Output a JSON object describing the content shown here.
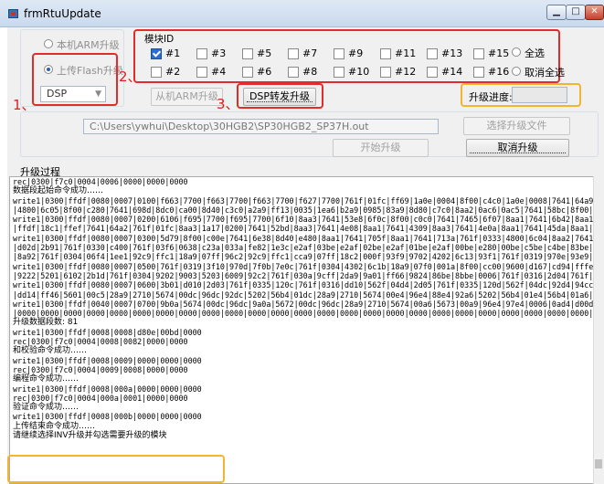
{
  "window": {
    "title": "frmRtuUpdate"
  },
  "mode": {
    "local_arm_label": "本机ARM升级",
    "upload_flash_label": "上传Flash升级",
    "selected": "upload_flash"
  },
  "device_select": {
    "value": "DSP"
  },
  "module": {
    "title": "模块ID",
    "ids": [
      {
        "label": "#1",
        "checked": true
      },
      {
        "label": "#3",
        "checked": false
      },
      {
        "label": "#5",
        "checked": false
      },
      {
        "label": "#7",
        "checked": false
      },
      {
        "label": "#9",
        "checked": false
      },
      {
        "label": "#11",
        "checked": false
      },
      {
        "label": "#13",
        "checked": false
      },
      {
        "label": "#15",
        "checked": false
      },
      {
        "label": "#2",
        "checked": false
      },
      {
        "label": "#4",
        "checked": false
      },
      {
        "label": "#6",
        "checked": false
      },
      {
        "label": "#8",
        "checked": false
      },
      {
        "label": "#10",
        "checked": false
      },
      {
        "label": "#12",
        "checked": false
      },
      {
        "label": "#14",
        "checked": false
      },
      {
        "label": "#16",
        "checked": false
      }
    ],
    "select_all_label": "全选",
    "cancel_all_label": "取消全选"
  },
  "actions": {
    "arm_upgrade_label": "从机ARM升级",
    "dsp_upgrade_label": "DSP转发升级",
    "start_upgrade_label": "开始升级",
    "cancel_upgrade_label": "取消升级",
    "select_file_label": "选择升级文件"
  },
  "progress": {
    "label": "升级进度:",
    "value": ""
  },
  "file": {
    "path": "C:\\Users\\ywhui\\Desktop\\30HGB2\\SP30HGB2_SP37H.out"
  },
  "annotations": {
    "n1": "1、",
    "n2": "2、",
    "n3": "3、"
  },
  "log": {
    "title": "升级过程",
    "lines": [
      "rec|0300|f7c0|0004|0006|0000|0000|0000",
      "数据段起始命令成功……",
      "write1|0300|ffdf|0080|0007|0100|f663|7700|f663|7700|f663|7700|f627|7700|761f|01fc|ff69|1a0e|0004|8f00|c4c0|1a0e|0008|7641|64a9|8d40|c640|8aa1|7641|d6e0|c6e8|",
      "|4800|6c05|8f00|c280|7641|698d|8dc0|ca00|8d40|c3c0|a2a9|ff13|0035|1ea6|b2a9|0985|83a9|8d80|c7c0|8aa2|0ac6|0ac5|7641|58bc|8f00|c4c0|a842|92c4|6113|0ae4|",
      "write1|0300|ffdf|0080|0007|0200|6106|f695|7700|f695|7700|6f10|8aa3|7641|53e8|6f0c|8f00|c0c0|7641|7465|6f07|8aa1|7641|6b42|8aa1|7641|69f5|8d40|c640|8aa1|",
      "|ffdf|18c1|ffef|7641|64a2|761f|01fc|8aa3|1a17|0200|7641|52bd|8aa3|7641|4e08|8aa1|7641|4309|8aa3|7641|4e0a|8aa1|7641|45da|8aa1|7641|4cee|8aa1|7641|4645|",
      "write1|0300|ffdf|0080|0007|0300|5d79|8f00|c00e|7641|6e38|8d40|e480|8aa1|7641|705f|8aa1|7641|713a|761f|0333|4800|6c04|8aa2|7641|74cd|8d40|c180|8aa1|7641|",
      "|d02d|2b91|761f|0330|c400|761f|03f6|0638|c23a|033a|fe82|1e3c|e2af|03be|e2af|02be|e2af|01be|e2af|00be|e280|00be|c5be|c4be|83be|8abe|82be|86be|87be|81be|",
      "|8a92|761f|0304|06f4|1ee1|92c9|ffc1|18a9|07ff|96c2|92c9|ffc1|cca9|07ff|18c2|000f|93f9|9702|4202|6c13|93f1|761f|0319|970e|93e9|970f|761f|032a|8009|8804|",
      "write1|0300|ffdf|0080|0007|0500|761f|0319|3f10|970d|7f0b|7e0c|761f|0304|4302|6c1b|18a9|07f0|001a|8f00|cc00|9600|d167|cd94|fffe|d068|cc00|0100|56bf|0005|",
      "|9222|5201|6102|2b1d|761f|0304|9202|9003|5203|6009|92c2|761f|030a|9cff|2da9|9a01|ff66|9824|86be|8bbe|0006|761f|0316|2d04|761f|0335|83a4|120b|7610|",
      "write1|0300|ffdf|0080|0007|0600|3b01|d010|2d03|761f|0335|120c|761f|0316|dd10|562f|04d4|2d05|761f|0335|120d|562f|04dc|92d4|94cc|96e4|92cc|9ed4|96ec|",
      "|dd14|ff46|5601|00c5|28a9|2710|5674|00dc|96dc|92dc|5202|56b4|01dc|28a9|2710|5674|00e4|96e4|88e4|92a6|5202|56b4|01e4|56b4|01a6|25e4|03f4|ff41|56b4|",
      "write1|0300|ffdf|0040|0007|0700|9b0a|5674|00dc|96dc|9a0a|5672|00dc|96dc|28a9|2710|5674|00a6|5673|00a9|96e4|97e4|0006|0ad4|d00d|18cc|fffe|92d4|9e94|",
      "|0000|0000|0000|0000|0000|0000|0000|0000|0000|0000|0000|0000|0000|0000|0000|0000|0000|0000|0000|0000|0000|0000|0000|0000|0000|0000|0000|0000|0000|0000|",
      "升级数据段数: 81",
      "write1|0300|ffdf|0008|0008|d80e|00bd|0000",
      "rec|0300|f7c0|0004|0008|0082|0000|0000",
      "和校验命令成功……",
      "write1|0300|ffdf|0008|0009|0000|0000|0000",
      "rec|0300|f7c0|0004|0009|0008|0000|0000",
      "编程命令成功……",
      "write1|0300|ffdf|0008|000a|0000|0000|0000",
      "rec|0300|f7c0|0004|000a|0001|0000|0000",
      "验证命令成功……",
      "write1|0300|ffdf|0008|000b|0000|0000|0000",
      "上传结束命令成功……",
      "请继续选择INV升级并勾选需要升级的模块"
    ]
  }
}
